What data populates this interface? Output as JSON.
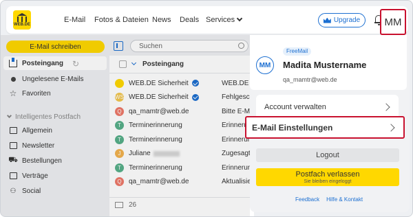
{
  "brand": {
    "logo_text": "WEB.DE",
    "accent": "#ffd800",
    "link_color": "#1c6fd1",
    "highlight": "#c8102e"
  },
  "nav": {
    "email": "E-Mail",
    "fotos": "Fotos & Dateien",
    "news": "News",
    "deals": "Deals",
    "services": "Services"
  },
  "header": {
    "upgrade": "Upgrade",
    "avatar_initials": "MM"
  },
  "sidebar": {
    "compose": "E-Mail schreiben",
    "items": [
      {
        "label": "Posteingang",
        "icon": "inbox-icon"
      },
      {
        "label": "Ungelesene E-Mails",
        "icon": "unread-dot-icon"
      },
      {
        "label": "Favoriten",
        "icon": "star-icon"
      }
    ],
    "section": "Intelligentes Postfach",
    "smart_items": [
      {
        "label": "Allgemein",
        "icon": "general-icon"
      },
      {
        "label": "Newsletter",
        "icon": "newsletter-icon"
      },
      {
        "label": "Bestellungen",
        "icon": "cart-icon"
      },
      {
        "label": "Verträge",
        "icon": "contract-icon"
      },
      {
        "label": "Social",
        "icon": "social-icon"
      }
    ]
  },
  "search": {
    "placeholder": "Suchen"
  },
  "list": {
    "header": "Posteingang",
    "rows": [
      {
        "avatar": "",
        "sender": "WEB.DE Sicherheit",
        "verified": true,
        "subject": "WEB.DE Sicherheit",
        "color": "#ffd800"
      },
      {
        "avatar": "WS",
        "sender": "WEB.DE Sicherheit",
        "verified": true,
        "subject": "Fehlgeschlage",
        "color": "#f3c74f"
      },
      {
        "avatar": "Q",
        "sender": "qa_mamtr@web.de",
        "verified": false,
        "subject": "Bitte E-Mail a",
        "color": "#ef7a6a"
      },
      {
        "avatar": "T",
        "sender": "Terminerinnerung",
        "verified": false,
        "subject": "Erinnerung: M",
        "color": "#58b08a"
      },
      {
        "avatar": "T",
        "sender": "Terminerinnerung",
        "verified": false,
        "subject": "Erinnerung: M",
        "color": "#58b08a"
      },
      {
        "avatar": "J",
        "sender": "Juliane",
        "verified": false,
        "subject": "Zugesagt: Me",
        "color": "#f3b34f"
      },
      {
        "avatar": "T",
        "sender": "Terminerinnerung",
        "verified": false,
        "subject": "Erinnerung: M",
        "color": "#58b08a"
      },
      {
        "avatar": "Q",
        "sender": "qa_mamtr@web.de",
        "verified": false,
        "subject": "Aktualisierte",
        "color": "#ef7a6a"
      }
    ],
    "count": "26"
  },
  "account": {
    "plan": "FreeMail",
    "initials": "MM",
    "name": "Madita Mustername",
    "email": "qa_mamtr@web.de",
    "manage": "Account verwalten",
    "settings": "E-Mail Einstellungen",
    "logout": "Logout",
    "leave": "Postfach verlassen",
    "leave_sub": "Sie bleiben eingeloggt",
    "feedback": "Feedback",
    "help": "Hilfe & Kontakt"
  }
}
